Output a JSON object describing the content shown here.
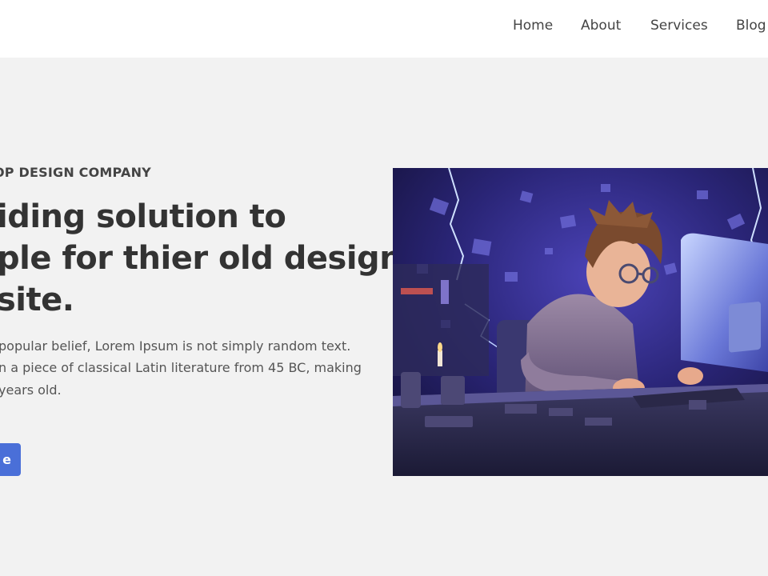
{
  "nav": {
    "items": [
      "Home",
      "About",
      "Services",
      "Blog"
    ]
  },
  "hero": {
    "eyebrow": "OP DESIGN COMPANY",
    "headline_lines": [
      "iding solution to",
      "ple for thier old design",
      "site."
    ],
    "description_lines": [
      "popular belief, Lorem Ipsum is not simply random text.",
      "n a piece of classical Latin literature from 45 BC, making",
      "years old."
    ],
    "cta_label": "e",
    "image_alt": "3D illustration of a young designer with glasses working at a computer in a dark room with blue lightning"
  },
  "colors": {
    "accent": "#4a6fd8",
    "background": "#f2f2f2",
    "navbar": "#ffffff",
    "text_dark": "#333333"
  }
}
